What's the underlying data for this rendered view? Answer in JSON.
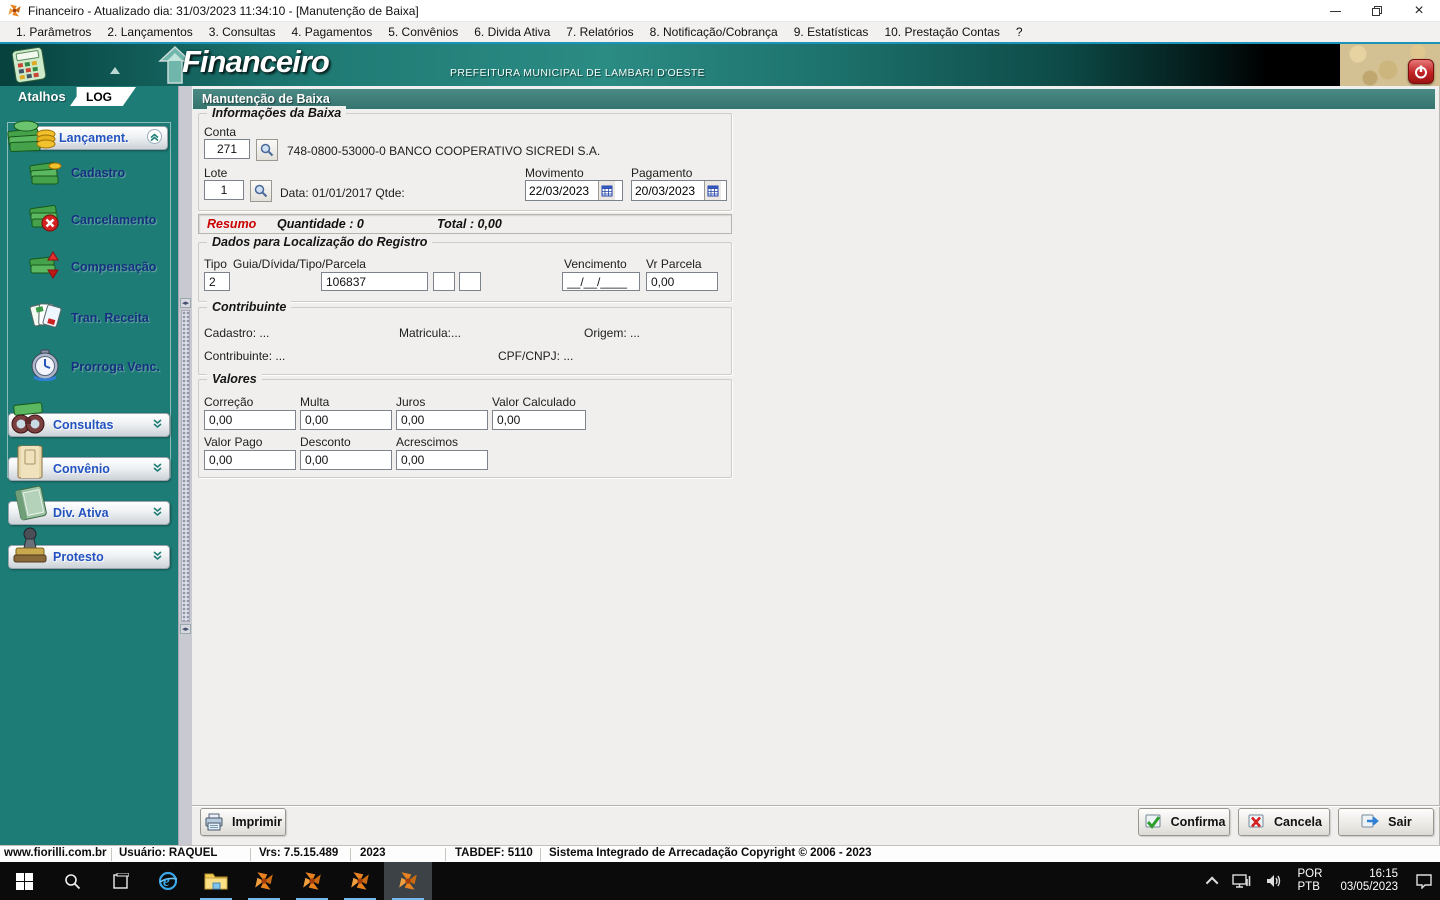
{
  "window": {
    "title": "Financeiro - Atualizado dia: 31/03/2023 11:34:10 - [Manutenção de Baixa]"
  },
  "menu": {
    "items": [
      "1. Parâmetros",
      "2. Lançamentos",
      "3. Consultas",
      "4. Pagamentos",
      "5. Convênios",
      "6. Divida Ativa",
      "7. Relatórios",
      "8. Notificação/Cobrança",
      "9. Estatísticas",
      "10. Prestação Contas",
      "?"
    ]
  },
  "header": {
    "app_name": "Financeiro",
    "subtitle": "PREFEITURA MUNICIPAL DE LAMBARI D'OESTE"
  },
  "sidebar": {
    "tab_atalhos": "Atalhos",
    "tab_log": "LOG",
    "group_lancamento": {
      "label": "Lançament."
    },
    "items": [
      {
        "label": "Cadastro"
      },
      {
        "label": "Cancelamento"
      },
      {
        "label": "Compensação"
      },
      {
        "label": "Tran. Receita"
      },
      {
        "label": "Prorroga Venc."
      }
    ],
    "groups_collapsed": [
      {
        "label": "Consultas"
      },
      {
        "label": "Convênio"
      },
      {
        "label": "Div. Ativa"
      },
      {
        "label": "Protesto"
      }
    ]
  },
  "form": {
    "title": "Manutenção de Baixa",
    "info": {
      "legend": "Informações da Baixa",
      "conta_label": "Conta",
      "conta_value": "271",
      "conta_desc": "748-0800-53000-0 BANCO COOPERATIVO SICREDI S.A.",
      "lote_label": "Lote",
      "lote_value": "1",
      "lote_desc": "Data: 01/01/2017 Qtde:",
      "movimento_label": "Movimento",
      "movimento_value": "22/03/2023",
      "pagamento_label": "Pagamento",
      "pagamento_value": "20/03/2023"
    },
    "resumo": {
      "label": "Resumo",
      "quantidade": "Quantidade : 0",
      "total": "Total : 0,00"
    },
    "localizacao": {
      "legend": "Dados para Localização do Registro",
      "tipo_label": "Tipo",
      "tipo_value": "2",
      "guia_label": "Guia/Dívida/Tipo/Parcela",
      "guia_value": "106837",
      "vencimento_label": "Vencimento",
      "vencimento_value": "__/__/____",
      "vr_parcela_label": "Vr Parcela",
      "vr_parcela_value": "0,00"
    },
    "contribuinte": {
      "legend": "Contribuinte",
      "cadastro": "Cadastro: ...",
      "matricula": "Matricula:...",
      "origem": "Origem: ...",
      "contribuinte": "Contribuinte: ...",
      "cpf_cnpj": "CPF/CNPJ: ..."
    },
    "valores": {
      "legend": "Valores",
      "fields": [
        {
          "label": "Correção",
          "value": "0,00"
        },
        {
          "label": "Multa",
          "value": "0,00"
        },
        {
          "label": "Juros",
          "value": "0,00"
        },
        {
          "label": "Valor Calculado",
          "value": "0,00"
        },
        {
          "label": "Valor Pago",
          "value": "0,00"
        },
        {
          "label": "Desconto",
          "value": "0,00"
        },
        {
          "label": "Acrescimos",
          "value": "0,00"
        }
      ]
    },
    "buttons": {
      "imprimir": "Imprimir",
      "confirma": "Confirma",
      "cancela": "Cancela",
      "sair": "Sair"
    }
  },
  "statusbar": {
    "segments": [
      "www.fiorilli.com.br",
      "Usuário: RAQUEL",
      "Vrs: 7.5.15.489",
      "2023",
      "TABDEF: 5110",
      "Sistema Integrado de Arrecadação Copyright © 2006 - 2023"
    ]
  },
  "taskbar": {
    "lang_line1": "POR",
    "lang_line2": "PTB",
    "time": "16:15",
    "date": "03/05/2023"
  },
  "icons": {
    "app": "orange-pinwheel",
    "power": "power-symbol",
    "search_lookup": "magnifier",
    "calendar": "calendar-grid",
    "print": "printer",
    "confirm": "green-check-box",
    "cancel": "red-x-box",
    "exit": "blue-arrow-box"
  },
  "colors": {
    "header_teal": "#2b8c84",
    "sidebar_teal": "#1e7c76",
    "form_title_teal": "#3a7d79",
    "resumo_red": "#cc0000",
    "taskbar_underline": "#76b9ed",
    "power_red": "#c22424"
  }
}
